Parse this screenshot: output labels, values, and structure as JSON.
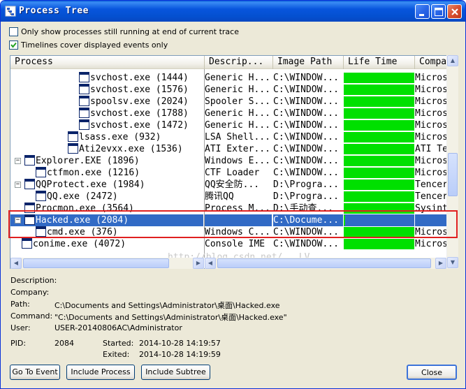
{
  "window": {
    "title": "Process Tree"
  },
  "options": {
    "only_running_label": "Only show processes still running at end of current trace",
    "only_running_checked": false,
    "timelines_label": "Timelines cover displayed events only",
    "timelines_checked": true
  },
  "columns": [
    "Process",
    "Descrip...",
    "Image Path",
    "Life Time",
    "Compa"
  ],
  "rows": [
    {
      "name": "svchost.exe (1444)",
      "desc": "Generic H...",
      "path": "C:\\WINDOW...",
      "company": "Micros",
      "level": 5,
      "expander": "",
      "icon": "process-window-icon",
      "life": 1
    },
    {
      "name": "svchost.exe (1576)",
      "desc": "Generic H...",
      "path": "C:\\WINDOW...",
      "company": "Micros",
      "level": 5,
      "expander": "",
      "icon": "process-window-icon",
      "life": 1
    },
    {
      "name": "spoolsv.exe (2024)",
      "desc": "Spooler S...",
      "path": "C:\\WINDOW...",
      "company": "Micros",
      "level": 5,
      "expander": "",
      "icon": "process-window-icon",
      "life": 1
    },
    {
      "name": "svchost.exe (1788)",
      "desc": "Generic H...",
      "path": "C:\\WINDOW...",
      "company": "Micros",
      "level": 5,
      "expander": "",
      "icon": "process-window-icon",
      "life": 1
    },
    {
      "name": "svchost.exe (1472)",
      "desc": "Generic H...",
      "path": "C:\\WINDOW...",
      "company": "Micros",
      "level": 5,
      "expander": "",
      "icon": "process-window-icon",
      "life": 1
    },
    {
      "name": "lsass.exe (932)",
      "desc": "LSA Shell...",
      "path": "C:\\WINDOW...",
      "company": "Micros",
      "level": 4,
      "expander": "",
      "icon": "process-window-icon",
      "life": 1
    },
    {
      "name": "Ati2evxx.exe (1536)",
      "desc": "ATI Exter...",
      "path": "C:\\WINDOW...",
      "company": "ATI Te",
      "level": 4,
      "expander": "",
      "icon": "process-window-icon",
      "life": 1
    },
    {
      "name": "Explorer.EXE (1896)",
      "desc": "Windows E...",
      "path": "C:\\WINDOW...",
      "company": "Micros",
      "level": 1,
      "expander": "minus",
      "icon": "explorer-icon",
      "life": 1
    },
    {
      "name": "ctfmon.exe (1216)",
      "desc": "CTF Loader",
      "path": "C:\\WINDOW...",
      "company": "Micros",
      "level": 2,
      "expander": "",
      "icon": "ctfmon-icon",
      "life": 1
    },
    {
      "name": "QQProtect.exe (1984)",
      "desc": "QQ安全防...",
      "path": "D:\\Progra...",
      "company": "Tencer",
      "level": 1,
      "expander": "minus",
      "icon": "qq-icon",
      "life": 1
    },
    {
      "name": "QQ.exe (2472)",
      "desc": "腾讯QQ",
      "path": "D:\\Progra...",
      "company": "Tencer",
      "level": 2,
      "expander": "",
      "icon": "qq-icon",
      "life": 1
    },
    {
      "name": "Procmon.exe (3564)",
      "desc": "Process M...",
      "path": "D:\\手动查...",
      "company": "Sysint",
      "level": 1,
      "expander": "",
      "icon": "procmon-icon",
      "life": 1
    },
    {
      "name": "Hacked.exe (2084)",
      "desc": "",
      "path": "C:\\Docume...",
      "company": "",
      "level": 1,
      "expander": "minus",
      "icon": "hacked-exe-icon",
      "life": 0,
      "selected": true
    },
    {
      "name": "cmd.exe (376)",
      "desc": "Windows C...",
      "path": "C:\\WINDOW...",
      "company": "Micros",
      "level": 2,
      "expander": "",
      "icon": "cmd-icon",
      "life": 1
    },
    {
      "name": "conime.exe (4072)",
      "desc": "Console IME",
      "path": "C:\\WINDOW...",
      "company": "Micros",
      "level": 0,
      "expander": "",
      "icon": "conime-icon",
      "life": 1
    }
  ],
  "watermark": "http://blog.csdn.net/...LV",
  "details": {
    "description_label": "Description:",
    "description_value": "",
    "company_label": "Company:",
    "company_value": "",
    "path_label": "Path:",
    "path_value": "C:\\Documents and Settings\\Administrator\\桌面\\Hacked.exe",
    "command_label": "Command:",
    "command_value": "\"C:\\Documents and Settings\\Administrator\\桌面\\Hacked.exe\"",
    "user_label": "User:",
    "user_value": "USER-20140806AC\\Administrator",
    "pid_label": "PID:",
    "pid_value": "2084",
    "started_label": "Started:",
    "started_value": "2014-10-28 14:19:57",
    "exited_label": "Exited:",
    "exited_value": "2014-10-28 14:19:59"
  },
  "buttons": {
    "go_to_event": "Go To Event",
    "include_process": "Include Process",
    "include_subtree": "Include Subtree",
    "close": "Close"
  },
  "colors": {
    "selection": "#316ac5",
    "lifetime_bar": "#00e000",
    "highlight_box": "#e02020",
    "titlebar": "#0855dd"
  }
}
